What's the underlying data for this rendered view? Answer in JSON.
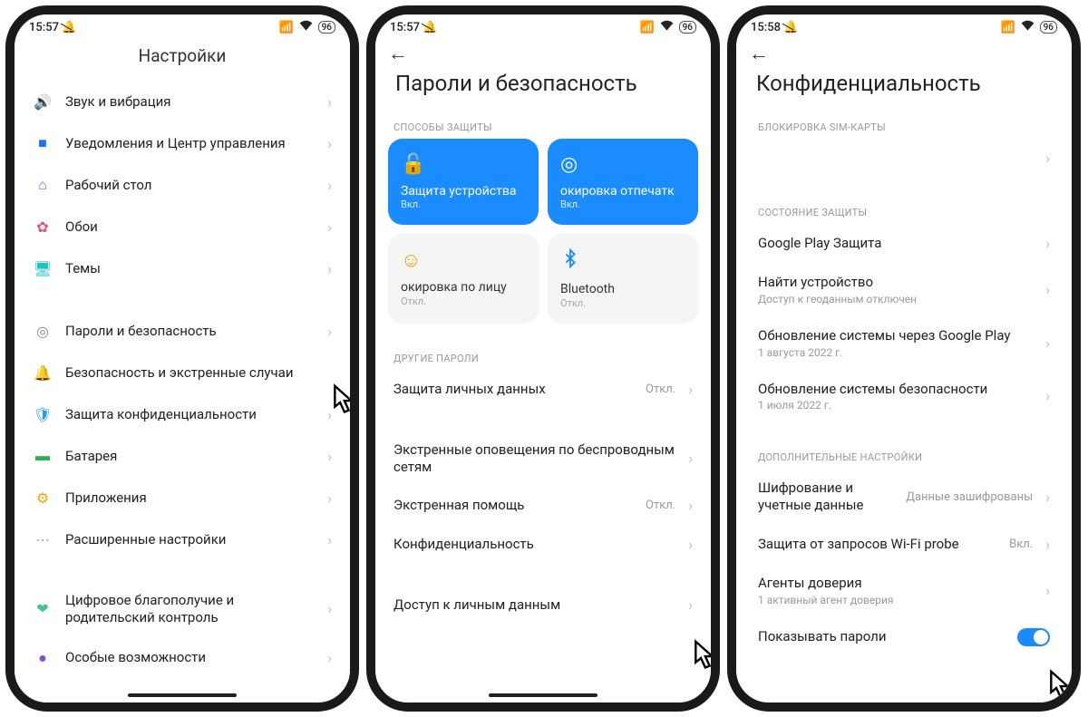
{
  "status": {
    "time1": "15:57",
    "time2": "15:57",
    "time3": "15:58",
    "battery": "96"
  },
  "screen1": {
    "title": "Настройки",
    "groupA": [
      {
        "label": "Звук и вибрация"
      },
      {
        "label": "Уведомления и Центр управления"
      },
      {
        "label": "Рабочий стол"
      },
      {
        "label": "Обои"
      },
      {
        "label": "Темы"
      }
    ],
    "groupB": [
      {
        "label": "Пароли и безопасность"
      },
      {
        "label": "Безопасность и экстренные случаи"
      },
      {
        "label": "Защита конфиденциальности"
      },
      {
        "label": "Батарея"
      },
      {
        "label": "Приложения"
      },
      {
        "label": "Расширенные настройки"
      }
    ],
    "groupC": [
      {
        "label": "Цифровое благополучие и родительский контроль"
      },
      {
        "label": "Особые возможности"
      }
    ]
  },
  "screen2": {
    "title": "Пароли и безопасность",
    "section_protect": "СПОСОБЫ ЗАЩИТЫ",
    "cards": [
      {
        "title": "Защита устройства",
        "status": "Вкл."
      },
      {
        "title": "окировка отпечатк",
        "status": "Вкл."
      },
      {
        "title": "окировка по лицу",
        "status": "Откл."
      },
      {
        "title": "Bluetooth",
        "status": "Откл."
      }
    ],
    "section_other": "ДРУГИЕ ПАРОЛИ",
    "rows": [
      {
        "label": "Защита личных данных",
        "meta": "Откл."
      },
      {
        "label": "Экстренные оповещения по беспроводным сетям",
        "meta": ""
      },
      {
        "label": "Экстренная помощь",
        "meta": "Откл."
      },
      {
        "label": "Конфиденциальность",
        "meta": ""
      },
      {
        "label": "Доступ к личным данным",
        "meta": ""
      }
    ]
  },
  "screen3": {
    "title": "Конфиденциальность",
    "section_sim": "БЛОКИРОВКА SIM-КАРТЫ",
    "empty_row": "",
    "section_state": "СОСТОЯНИЕ ЗАЩИТЫ",
    "rowsA": [
      {
        "label": "Google Play Защита",
        "sub": ""
      },
      {
        "label": "Найти устройство",
        "sub": "Доступ к геоданным отключен"
      },
      {
        "label": "Обновление системы через Google Play",
        "sub": "1 августа 2022 г."
      },
      {
        "label": "Обновление системы безопасности",
        "sub": "1 июля 2022 г."
      }
    ],
    "section_more": "ДОПОЛНИТЕЛЬНЫЕ НАСТРОЙКИ",
    "rowsB": [
      {
        "label": "Шифрование и учетные данные",
        "meta": "Данные зашифрованы"
      },
      {
        "label": "Защита от запросов Wi-Fi probe",
        "meta": "Вкл."
      },
      {
        "label": "Агенты доверия",
        "sub": "1 активный агент доверия"
      },
      {
        "label": "Показывать пароли",
        "sub": ""
      }
    ]
  }
}
